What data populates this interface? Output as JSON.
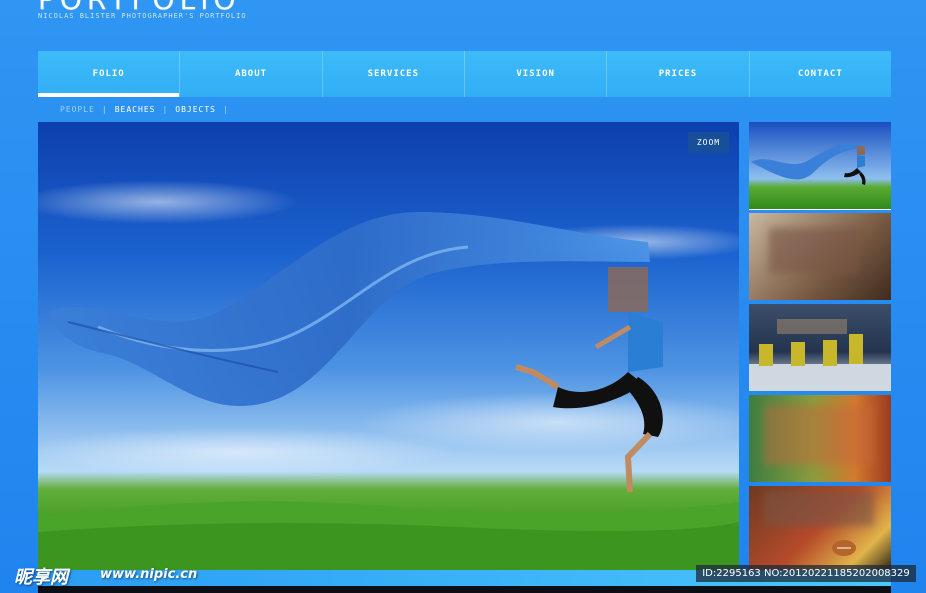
{
  "header": {
    "logo_text": "PORTFOLIO",
    "subtitle": "NICOLAS BLISTER PHOTOGRAPHER'S PORTFOLIO"
  },
  "nav": {
    "items": [
      {
        "label": "FOLIO",
        "active": true
      },
      {
        "label": "ABOUT",
        "active": false
      },
      {
        "label": "SERVICES",
        "active": false
      },
      {
        "label": "VISION",
        "active": false
      },
      {
        "label": "PRICES",
        "active": false
      },
      {
        "label": "CONTACT",
        "active": false
      }
    ]
  },
  "subnav": {
    "items": [
      {
        "label": "PEOPLE",
        "active": true
      },
      {
        "label": "BEACHES",
        "active": false
      },
      {
        "label": "OBJECTS",
        "active": false
      }
    ],
    "separator": "|"
  },
  "main_photo": {
    "zoom_label": "ZOOM"
  },
  "thumbnails": [
    {
      "subject": "jumping-woman-blue-scarf"
    },
    {
      "subject": "beach-people"
    },
    {
      "subject": "skiers"
    },
    {
      "subject": "objects-green-orange"
    },
    {
      "subject": "football-player"
    }
  ],
  "watermark": {
    "logo": "昵享网",
    "url": "www.nipic.cn",
    "id_text": "ID:2295163 NO:20120221185202008329"
  },
  "colors": {
    "background": "#2a8ef2",
    "nav": "#35b3f7",
    "zoom_button": "#174f9a",
    "text": "#ffffff"
  }
}
